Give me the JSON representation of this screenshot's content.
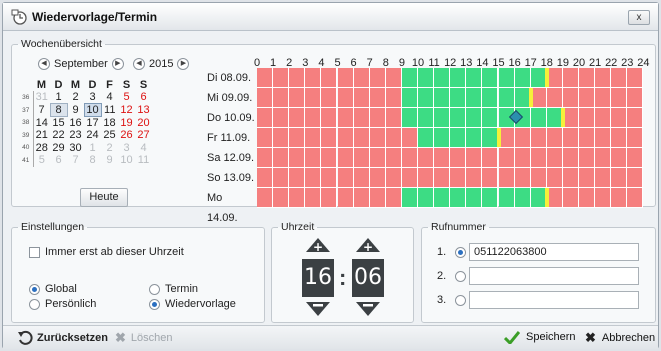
{
  "window": {
    "title": "Wiedervorlage/Termin",
    "close_label": "x"
  },
  "week": {
    "legend": "Wochenübersicht",
    "calendar": {
      "month": "September",
      "year": "2015",
      "weekday_headers": [
        "M",
        "D",
        "M",
        "D",
        "F",
        "S",
        "S"
      ],
      "weeks": [
        {
          "wk": "36",
          "days": [
            {
              "t": "31",
              "s": "o"
            },
            {
              "t": "1"
            },
            {
              "t": "2"
            },
            {
              "t": "3"
            },
            {
              "t": "4"
            },
            {
              "t": "5",
              "s": "r"
            },
            {
              "t": "6",
              "s": "r"
            }
          ]
        },
        {
          "wk": "37",
          "days": [
            {
              "t": "7"
            },
            {
              "t": "8",
              "s": "sel"
            },
            {
              "t": "9"
            },
            {
              "t": "10",
              "s": "today"
            },
            {
              "t": "11"
            },
            {
              "t": "12",
              "s": "r"
            },
            {
              "t": "13",
              "s": "r"
            }
          ]
        },
        {
          "wk": "38",
          "days": [
            {
              "t": "14"
            },
            {
              "t": "15"
            },
            {
              "t": "16"
            },
            {
              "t": "17"
            },
            {
              "t": "18"
            },
            {
              "t": "19",
              "s": "r"
            },
            {
              "t": "20",
              "s": "r"
            }
          ]
        },
        {
          "wk": "39",
          "days": [
            {
              "t": "21"
            },
            {
              "t": "22"
            },
            {
              "t": "23"
            },
            {
              "t": "24"
            },
            {
              "t": "25"
            },
            {
              "t": "26",
              "s": "r"
            },
            {
              "t": "27",
              "s": "r"
            }
          ]
        },
        {
          "wk": "40",
          "days": [
            {
              "t": "28"
            },
            {
              "t": "29"
            },
            {
              "t": "30"
            },
            {
              "t": "1",
              "s": "o"
            },
            {
              "t": "2",
              "s": "o"
            },
            {
              "t": "3",
              "s": "o"
            },
            {
              "t": "4",
              "s": "o"
            }
          ]
        },
        {
          "wk": "41",
          "days": [
            {
              "t": "5",
              "s": "o"
            },
            {
              "t": "6",
              "s": "o"
            },
            {
              "t": "7",
              "s": "o"
            },
            {
              "t": "8",
              "s": "o"
            },
            {
              "t": "9",
              "s": "o"
            },
            {
              "t": "10",
              "s": "o"
            },
            {
              "t": "11",
              "s": "o"
            }
          ]
        }
      ],
      "today_button": "Heute"
    },
    "schedule": {
      "hours": [
        "0",
        "1",
        "2",
        "3",
        "4",
        "5",
        "6",
        "7",
        "8",
        "9",
        "10",
        "11",
        "12",
        "13",
        "14",
        "15",
        "16",
        "17",
        "18",
        "19",
        "20",
        "21",
        "22",
        "23",
        "24"
      ],
      "colors": {
        "busy": "#f57f7f",
        "free": "#3ddc84",
        "marker": "#f5f03a"
      },
      "days": [
        {
          "label": "Di 08.09.",
          "free_from": 9,
          "free_to": 18,
          "marker_at": 17.5
        },
        {
          "label": "Mi 09.09.",
          "free_from": 9,
          "free_to": 17,
          "marker_at": 16.5
        },
        {
          "label": "Do 10.09.",
          "free_from": 9,
          "free_to": 19,
          "marker_at": 18.5
        },
        {
          "label": "Fr 11.09.",
          "free_from": 10,
          "free_to": 15,
          "marker_at": 14.5
        },
        {
          "label": "Sa 12.09.",
          "free_from": null,
          "free_to": null,
          "marker_at": null
        },
        {
          "label": "So 13.09.",
          "free_from": null,
          "free_to": null,
          "marker_at": null
        },
        {
          "label": "Mo 14.09.",
          "free_from": 9,
          "free_to": 18,
          "marker_at": 17.5
        }
      ],
      "selection": {
        "day_index": 2,
        "time": 16.1
      }
    }
  },
  "settings": {
    "legend": "Einstellungen",
    "always_label": "Immer erst ab dieser Uhrzeit",
    "options": [
      {
        "label": "Global",
        "checked": true
      },
      {
        "label": "Termin",
        "checked": false
      },
      {
        "label": "Persönlich",
        "checked": false
      },
      {
        "label": "Wiedervorlage",
        "checked": true
      }
    ]
  },
  "time": {
    "legend": "Uhrzeit",
    "hour": "16",
    "minute": "06",
    "separator": ":"
  },
  "phone": {
    "legend": "Rufnummer",
    "rows": [
      {
        "num": "1.",
        "value": "051122063800",
        "selected": true
      },
      {
        "num": "2.",
        "value": "",
        "selected": false
      },
      {
        "num": "3.",
        "value": "",
        "selected": false
      }
    ]
  },
  "footer": {
    "reset_label": "Zurücksetzen",
    "delete_label": "Löschen",
    "save_label": "Speichern",
    "cancel_label": "Abbrechen"
  }
}
